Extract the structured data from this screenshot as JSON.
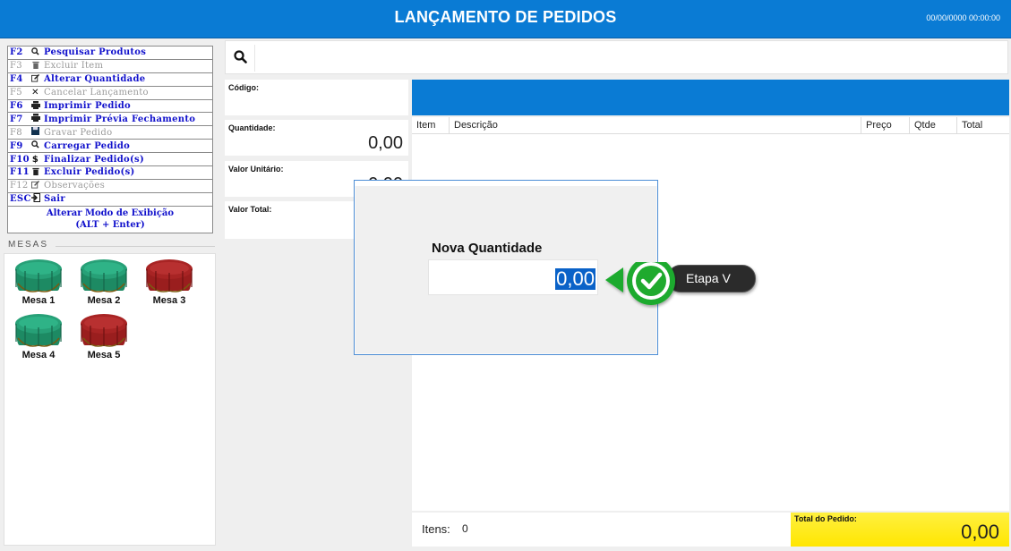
{
  "header": {
    "title": "LANÇAMENTO DE PEDIDOS",
    "clock": "00/00/0000 00:00:00"
  },
  "shortcuts": [
    {
      "key": "F2",
      "icon": "search-icon",
      "label": "Pesquisar Produtos",
      "enabled": true
    },
    {
      "key": "F3",
      "icon": "trash-icon",
      "label": "Excluir Item",
      "enabled": false
    },
    {
      "key": "F4",
      "icon": "edit-icon",
      "label": "Alterar Quantidade",
      "enabled": true
    },
    {
      "key": "F5",
      "icon": "close-icon",
      "label": "Cancelar Lançamento",
      "enabled": false
    },
    {
      "key": "F6",
      "icon": "printer-icon",
      "label": "Imprimir Pedido",
      "enabled": true
    },
    {
      "key": "F7",
      "icon": "printer-icon",
      "label": "Imprimir Prévia Fechamento",
      "enabled": true
    },
    {
      "key": "F8",
      "icon": "save-icon",
      "label": "Gravar Pedido",
      "enabled": false
    },
    {
      "key": "F9",
      "icon": "search-icon",
      "label": "Carregar Pedido",
      "enabled": true
    },
    {
      "key": "F10",
      "icon": "dollar-icon",
      "label": "Finalizar Pedido(s)",
      "enabled": true
    },
    {
      "key": "F11",
      "icon": "trash-icon",
      "label": "Excluir Pedido(s)",
      "enabled": true
    },
    {
      "key": "F12",
      "icon": "edit-icon",
      "label": "Observações",
      "enabled": false
    },
    {
      "key": "ESC",
      "icon": "exit-icon",
      "label": "Sair",
      "enabled": true
    }
  ],
  "display_mode": {
    "line1": "Alterar Modo de Exibição",
    "line2": "(ALT + Enter)"
  },
  "mesas": {
    "title": "MESAS",
    "items": [
      {
        "label": "Mesa 1",
        "color": "#1d8a63"
      },
      {
        "label": "Mesa 2",
        "color": "#1d8a63"
      },
      {
        "label": "Mesa 3",
        "color": "#9a1e1e"
      },
      {
        "label": "Mesa 4",
        "color": "#1d8a63"
      },
      {
        "label": "Mesa 5",
        "color": "#9a1e1e"
      }
    ]
  },
  "fields": {
    "codigo_label": "Código:",
    "codigo_value": "",
    "quantidade_label": "Quantidade:",
    "quantidade_value": "0,00",
    "valor_unitario_label": "Valor Unitário:",
    "valor_unitario_value": "0,00",
    "valor_total_label": "Valor Total:",
    "valor_total_value": ""
  },
  "grid": {
    "columns": [
      "Item",
      "Descrição",
      "Preço",
      "Qtde",
      "Total"
    ]
  },
  "footer": {
    "itens_label": "Itens:",
    "itens_value": "0",
    "total_label": "Total do Pedido:",
    "total_value": "0,00"
  },
  "dialog": {
    "label": "Nova Quantidade",
    "value": "0,00"
  },
  "callout": {
    "text": "Etapa V",
    "icon": "check-icon"
  },
  "colors": {
    "accent": "#0a7bd4",
    "total_bg": "#ffe600",
    "callout_green": "#1faa2e"
  }
}
